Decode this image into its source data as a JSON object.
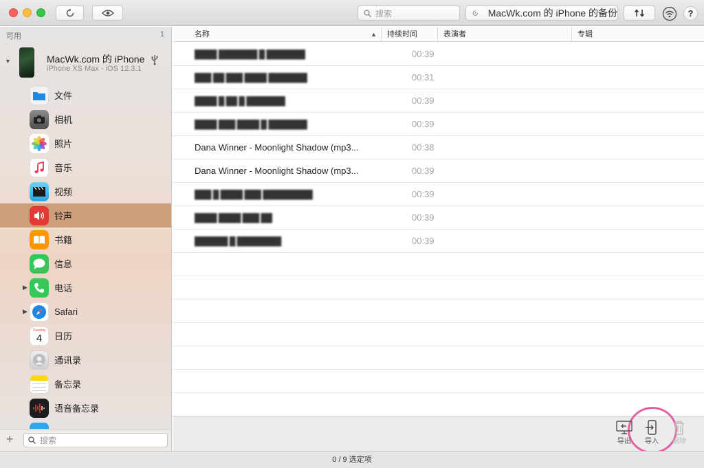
{
  "toolbar": {
    "search_placeholder": "搜索",
    "backup_label": "MacWk.com 的 iPhone 的备份",
    "help_label": "?"
  },
  "sidebar": {
    "header_label": "可用",
    "header_count": "1",
    "device_name": "MacWk.com 的 iPhone",
    "device_sub": "iPhone XS Max - iOS 12.3.1",
    "items": [
      {
        "label": "文件",
        "icon": "files-icon",
        "color": "#1e88e5"
      },
      {
        "label": "相机",
        "icon": "camera-icon",
        "color": "#555555"
      },
      {
        "label": "照片",
        "icon": "photos-icon",
        "color": "#ffffff"
      },
      {
        "label": "音乐",
        "icon": "music-icon",
        "color": "#ffffff"
      },
      {
        "label": "视频",
        "icon": "video-icon",
        "color": "#5ac8fa"
      },
      {
        "label": "铃声",
        "icon": "ringtone-icon",
        "color": "#e53935"
      },
      {
        "label": "书籍",
        "icon": "books-icon",
        "color": "#ff9500"
      },
      {
        "label": "信息",
        "icon": "messages-icon",
        "color": "#34c759"
      },
      {
        "label": "电话",
        "icon": "phone-icon",
        "color": "#34c759"
      },
      {
        "label": "Safari",
        "icon": "safari-icon",
        "color": "#1e88e5"
      },
      {
        "label": "日历",
        "icon": "calendar-icon",
        "color": "#ffffff"
      },
      {
        "label": "通讯录",
        "icon": "contacts-icon",
        "color": "#d7d7d7"
      },
      {
        "label": "备忘录",
        "icon": "notes-icon",
        "color": "#ffd60a"
      },
      {
        "label": "语音备忘录",
        "icon": "voice-memos-icon",
        "color": "#1c1c1e"
      }
    ],
    "calendar_weekday": "Tuesday",
    "calendar_day": "4",
    "search_placeholder": "搜索"
  },
  "table": {
    "columns": [
      "名称",
      "持续时间",
      "表演者",
      "专辑"
    ],
    "rows": [
      {
        "name": "████ ███████ █ ███████",
        "duration": "00:39",
        "redacted": true
      },
      {
        "name": "███ ██ ███ ████ ███████",
        "duration": "00:31",
        "redacted": true
      },
      {
        "name": "████ █ ██ █ ███████",
        "duration": "00:39",
        "redacted": true
      },
      {
        "name": "████ ███ ████ █ ███████",
        "duration": "00:39",
        "redacted": true
      },
      {
        "name": "Dana Winner - Moonlight Shadow (mp3...",
        "duration": "00:38",
        "redacted": false
      },
      {
        "name": "Dana Winner - Moonlight Shadow (mp3...",
        "duration": "00:39",
        "redacted": false
      },
      {
        "name": "███ █ ████ ███ █████████",
        "duration": "00:39",
        "redacted": true
      },
      {
        "name": "████ ████ ███ ██",
        "duration": "00:39",
        "redacted": true
      },
      {
        "name": "██████ █ ████████",
        "duration": "00:39",
        "redacted": true
      }
    ]
  },
  "bottom": {
    "export_label": "导出",
    "import_label": "导入",
    "delete_label": "删除"
  },
  "status": "0 / 9 选定项"
}
